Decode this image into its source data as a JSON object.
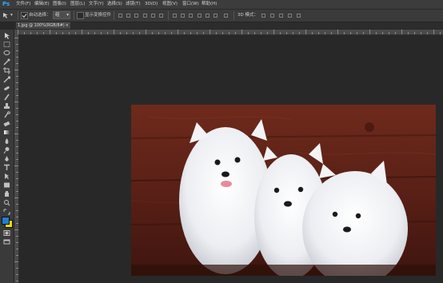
{
  "app": {
    "logo": "Ps",
    "menu": [
      "文件(F)",
      "编辑(E)",
      "图像(I)",
      "图层(L)",
      "文字(Y)",
      "选择(S)",
      "滤镜(T)",
      "3D(D)",
      "视图(V)",
      "窗口(W)",
      "帮助(H)"
    ]
  },
  "options": {
    "auto_select_label": "自动选择：",
    "auto_select_value": "组",
    "show_transform_label": "显示变换控件",
    "mode_3d_label": "3D 模式："
  },
  "document": {
    "tab_title": "1.jpg @ 100%(RGB/8#)",
    "tab_close": "×"
  },
  "colors": {
    "foreground": "#1e7fd6",
    "background": "#f5d80a"
  },
  "icons": {
    "move-tool": "move-icon",
    "marquee-tool": "marquee-icon",
    "lasso-tool": "lasso-icon",
    "quick-select-tool": "quick-select-icon",
    "crop-tool": "crop-icon",
    "eyedropper-tool": "eyedropper-icon",
    "healing-tool": "bandage-icon",
    "brush-tool": "brush-icon",
    "stamp-tool": "stamp-icon",
    "history-brush-tool": "history-brush-icon",
    "eraser-tool": "eraser-icon",
    "gradient-tool": "gradient-icon",
    "blur-tool": "blur-icon",
    "dodge-tool": "dodge-icon",
    "pen-tool": "pen-icon",
    "type-tool": "type-icon",
    "path-select-tool": "path-select-icon",
    "shape-tool": "shape-icon",
    "hand-tool": "hand-icon",
    "zoom-tool": "zoom-icon",
    "quick-mask": "quick-mask-icon",
    "screen-mode": "screen-mode-icon"
  }
}
